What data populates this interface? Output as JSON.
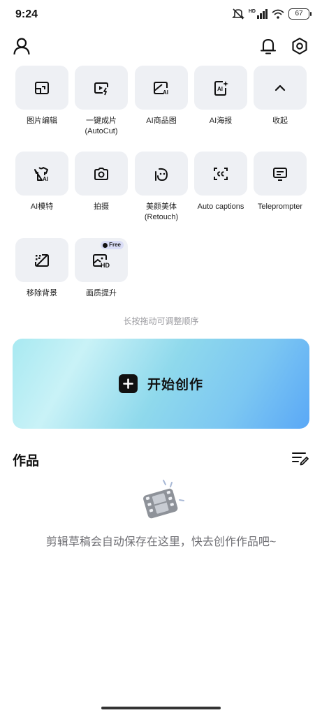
{
  "status_bar": {
    "time": "9:24",
    "network_label": "HD",
    "battery": "67"
  },
  "header": {
    "profile_icon": "user-icon",
    "notification_icon": "bell-icon",
    "settings_icon": "gear-icon"
  },
  "tools": [
    {
      "label": "图片编辑",
      "icon": "image-edit-icon"
    },
    {
      "label": "一键成片\n(AutoCut)",
      "icon": "autocut-icon"
    },
    {
      "label": "AI商品图",
      "icon": "ai-product-image-icon"
    },
    {
      "label": "AI海报",
      "icon": "ai-poster-icon"
    },
    {
      "label": "收起",
      "icon": "chevron-up-icon"
    },
    {
      "label": "AI模特",
      "icon": "ai-model-shirt-icon"
    },
    {
      "label": "拍摄",
      "icon": "camera-icon"
    },
    {
      "label": "美颜美体\n(Retouch)",
      "icon": "retouch-icon"
    },
    {
      "label": "Auto captions",
      "icon": "captions-icon"
    },
    {
      "label": "Teleprompter",
      "icon": "teleprompter-icon"
    },
    {
      "label": "移除背景",
      "icon": "remove-background-icon"
    },
    {
      "label": "画质提升",
      "icon": "hd-enhance-icon",
      "badge": "Free"
    }
  ],
  "hint": "长按拖动可调整顺序",
  "create_button": {
    "label": "开始创作"
  },
  "works": {
    "title": "作品",
    "empty_message": "剪辑草稿会自动保存在这里，快去创作作品吧~"
  }
}
